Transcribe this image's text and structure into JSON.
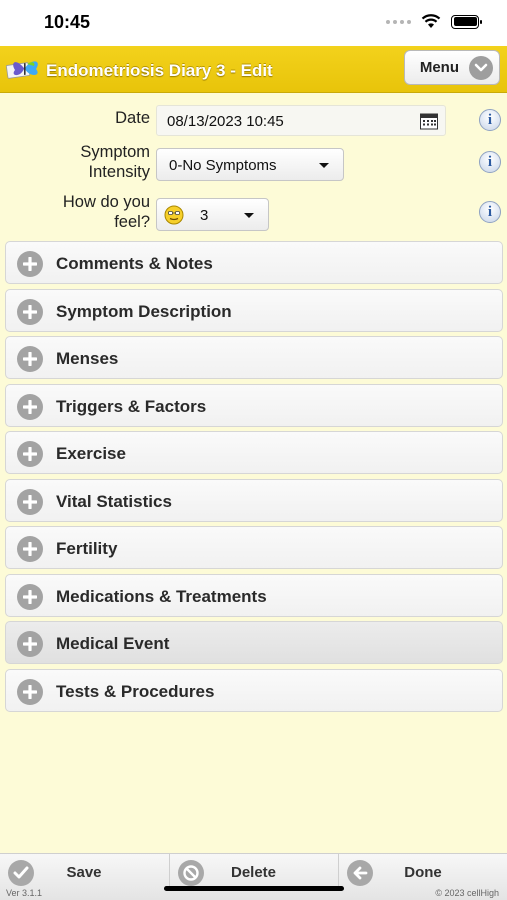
{
  "status_bar": {
    "time": "10:45"
  },
  "header": {
    "title": "Endometriosis Diary 3 - Edit",
    "menu_label": "Menu"
  },
  "form": {
    "date_label": "Date",
    "date_value": "08/13/2023 10:45",
    "intensity_label_line1": "Symptom",
    "intensity_label_line2": "Intensity",
    "intensity_value": "0-No Symptoms",
    "feel_label_line1": "How do you",
    "feel_label_line2": "feel?",
    "feel_value": "3"
  },
  "sections": [
    {
      "label": "Comments & Notes"
    },
    {
      "label": "Symptom Description"
    },
    {
      "label": "Menses"
    },
    {
      "label": "Triggers & Factors"
    },
    {
      "label": "Exercise"
    },
    {
      "label": "Vital Statistics"
    },
    {
      "label": "Fertility"
    },
    {
      "label": "Medications & Treatments"
    },
    {
      "label": "Medical Event"
    },
    {
      "label": "Tests & Procedures"
    }
  ],
  "bottom_bar": {
    "save_label": "Save",
    "delete_label": "Delete",
    "done_label": "Done",
    "version": "Ver 3.1.1",
    "copyright": "© 2023 cellHigh"
  },
  "icons": {
    "plus": "plus-circle-icon",
    "info": "info-icon",
    "calendar": "calendar-icon",
    "save": "checkmark-icon",
    "delete": "prohibit-icon",
    "done": "arrow-left-icon"
  },
  "colors": {
    "header_yellow": "#efcb12",
    "page_background": "#fdfbd7",
    "info_blue": "#2c5aa0"
  }
}
